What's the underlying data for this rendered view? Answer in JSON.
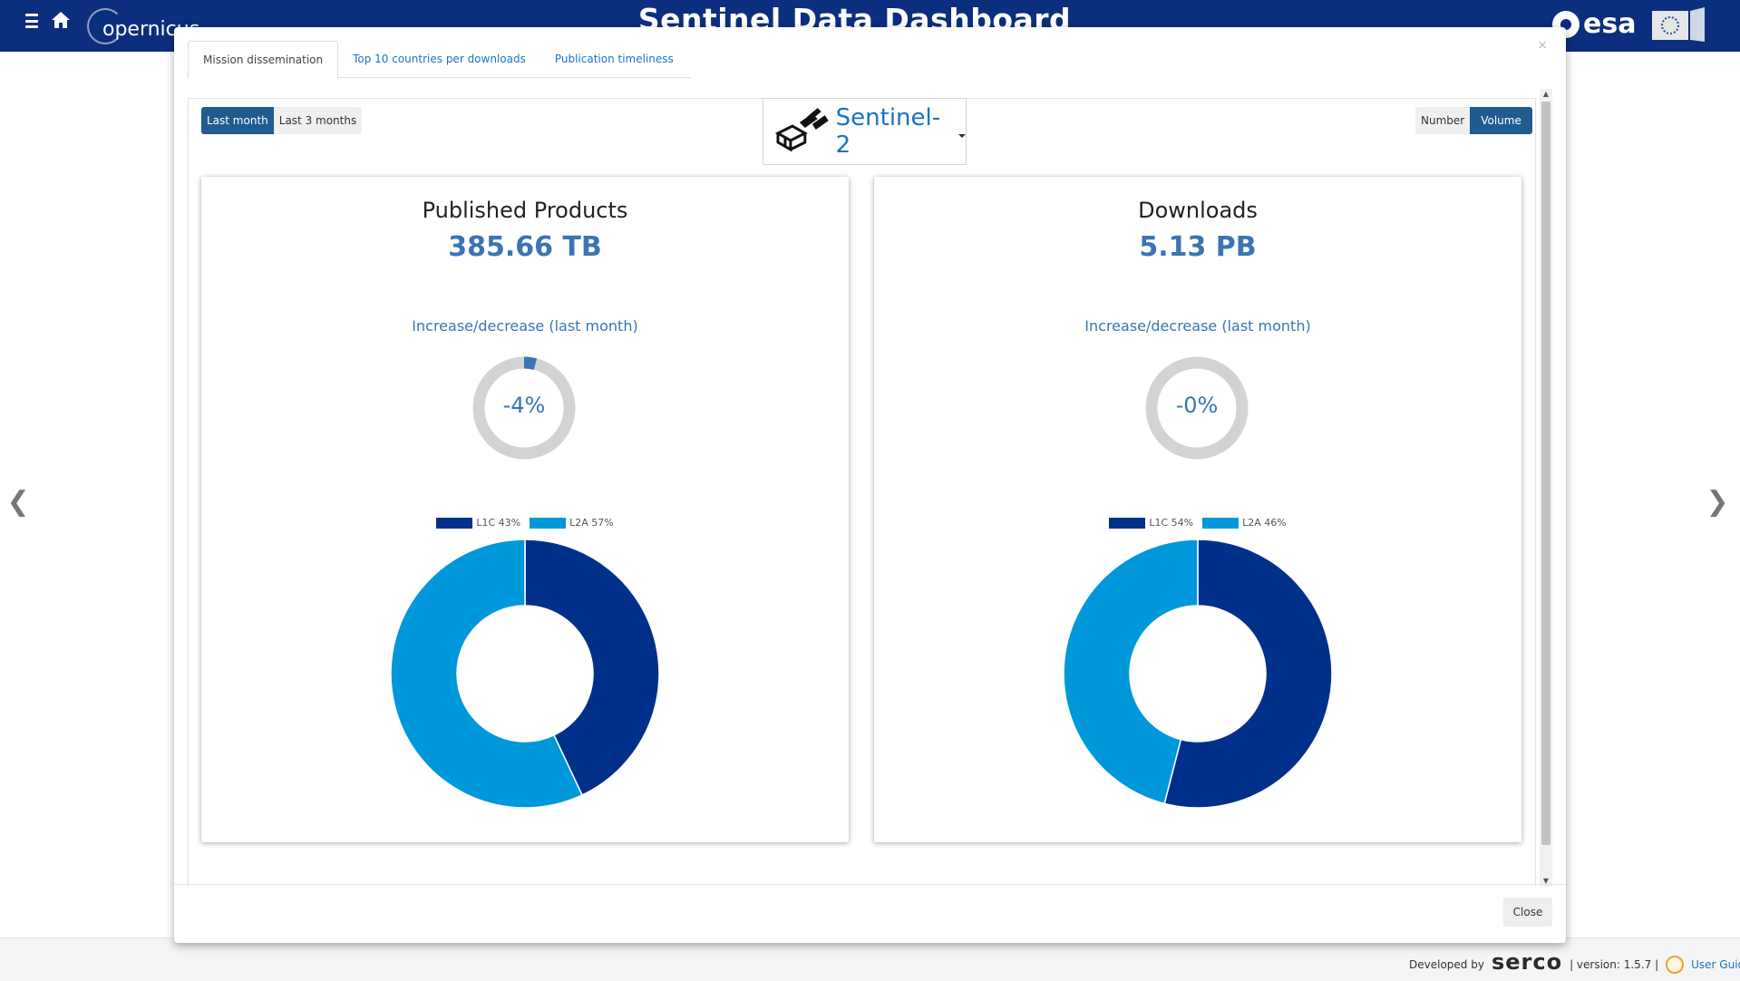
{
  "app": {
    "title": "Sentinel Data Dashboard",
    "logo_text": "opernicus",
    "esa_text": "esa"
  },
  "tabs": [
    {
      "label": "Mission dissemination",
      "active": true
    },
    {
      "label": "Top 10 countries per downloads",
      "active": false
    },
    {
      "label": "Publication timeliness",
      "active": false
    }
  ],
  "period": {
    "options": [
      "Last month",
      "Last 3 months"
    ],
    "selected": "Last month"
  },
  "metric": {
    "options": [
      "Number",
      "Volume"
    ],
    "selected": "Volume"
  },
  "mission": {
    "name": "Sentinel-2"
  },
  "cards": [
    {
      "title": "Published Products",
      "value": "385.66 TB",
      "change_label": "Increase/decrease (last month)",
      "change_text": "-4%",
      "change_pct": -4,
      "legend": [
        "L1C 43%",
        "L2A 57%"
      ],
      "chart_data": {
        "type": "pie",
        "categories": [
          "L1C",
          "L2A"
        ],
        "values": [
          43,
          57
        ],
        "colors": [
          "#00308a",
          "#0098db"
        ]
      }
    },
    {
      "title": "Downloads",
      "value": "5.13 PB",
      "change_label": "Increase/decrease (last month)",
      "change_text": "-0%",
      "change_pct": 0,
      "legend": [
        "L1C 54%",
        "L2A 46%"
      ],
      "chart_data": {
        "type": "pie",
        "categories": [
          "L1C",
          "L2A"
        ],
        "values": [
          54,
          46
        ],
        "colors": [
          "#00308a",
          "#0098db"
        ]
      }
    }
  ],
  "colors": {
    "header": "#0c2e7e",
    "accent": "#215b8f",
    "link": "#1a73c4",
    "gauge_track": "#d3d3d3",
    "gauge_fill": "#3a74b3"
  },
  "modal": {
    "close_label": "Close",
    "close_x": "×"
  },
  "footer": {
    "developed_by": "Developed by",
    "serco": "serco",
    "version": "| version: 1.5.7 |",
    "user_guide": "User Guide"
  },
  "nav": {
    "prev": "❮",
    "next": "❯"
  }
}
